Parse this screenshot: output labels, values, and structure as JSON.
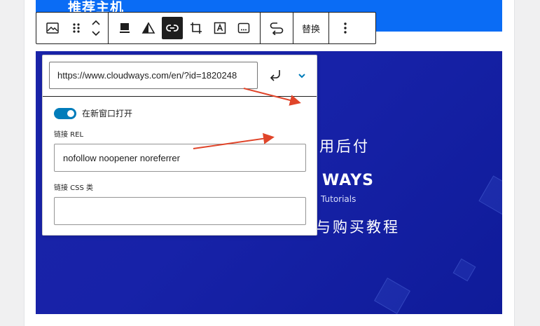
{
  "heading_block": {
    "text": "推荐主机"
  },
  "banner": {
    "line1": "用后付",
    "brand": "WAYS",
    "sub": "Tutorials",
    "line2": "与购买教程"
  },
  "toolbar": {
    "icons": [
      "image-icon",
      "drag-handle-icon",
      "move-up-down-icon",
      "align-icon",
      "duotone-icon",
      "link-icon",
      "crop-icon",
      "text-over-image-icon",
      "alt-text-icon",
      "replace-icon",
      "more-options-icon"
    ],
    "replace_label": "替换"
  },
  "link_popover": {
    "url_value": "https://www.cloudways.com/en/?id=1820248",
    "new_tab_label": "在新窗口打开",
    "new_tab_enabled": true,
    "rel_label": "链接 REL",
    "rel_value": "nofollow noopener noreferrer",
    "css_label": "链接 CSS 类",
    "css_value": ""
  },
  "colors": {
    "accent": "#007cba",
    "heading_bg": "#0a6cf5",
    "banner_bg": "#1722a8",
    "annotation_arrow": "#e0452a"
  }
}
